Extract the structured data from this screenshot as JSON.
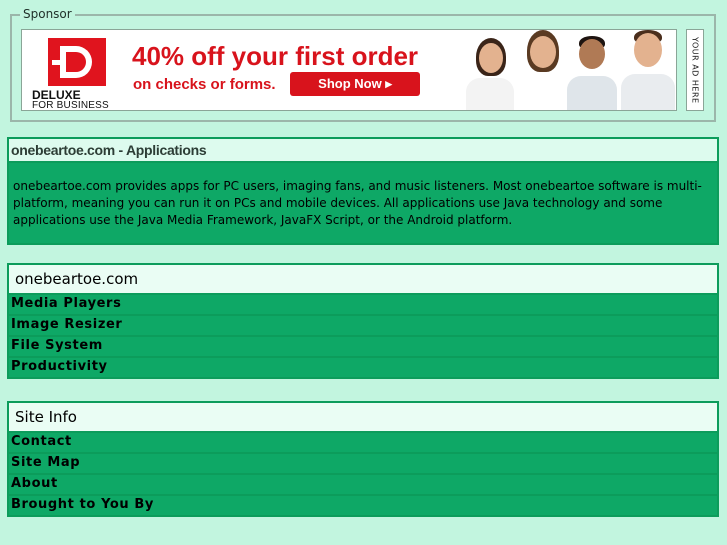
{
  "sponsor": {
    "legend": "Sponsor",
    "ad": {
      "brand": "DELUXE",
      "brand_sub": "FOR BUSINESS",
      "headline": "40% off your first order",
      "subline": "on checks or forms.",
      "cta": "Shop Now ▸",
      "side_label": "YOUR AD HERE",
      "accent_color": "#d8131c"
    }
  },
  "applications": {
    "title": "onebeartoe.com - Applications",
    "description": "onebeartoe.com provides apps for PC users, imaging fans, and music listeners.  Most onebeartoe software is multi-platform, meaning you can run it on PCs and mobile devices.  All applications use Java technology and some applications use the Java Media Framework, JavaFX Script, or the Android platform."
  },
  "menu_onebeartoe": {
    "title": "onebeartoe.com",
    "items": [
      "Media Players",
      "Image Resizer",
      "File System",
      "Productivity"
    ]
  },
  "menu_siteinfo": {
    "title": "Site Info",
    "items": [
      "Contact",
      "Site Map",
      "About",
      "Brought to You By"
    ]
  },
  "colors": {
    "page_background": "#c2f5df",
    "panel_green": "#0ea866",
    "border_green": "#0c9c5b"
  }
}
